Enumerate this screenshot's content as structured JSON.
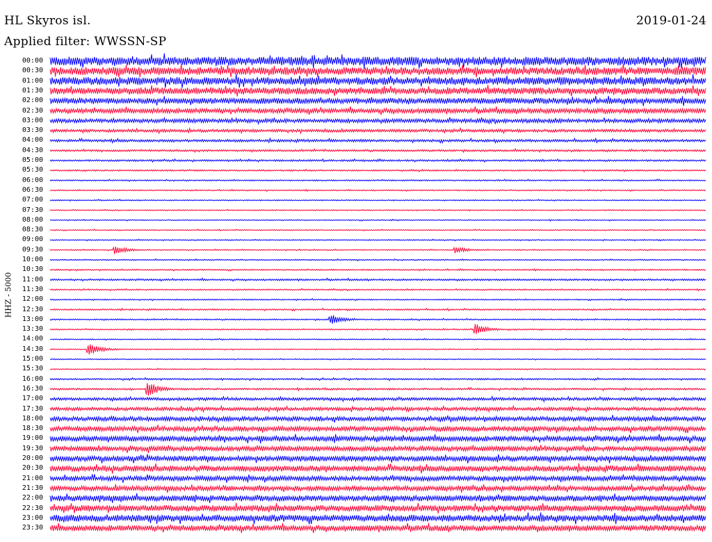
{
  "header": {
    "station": "HL Skyros isl.",
    "date": "2019-01-24",
    "filter": "Applied filter: WWSSN-SP"
  },
  "chart_data": {
    "type": "seismogram",
    "ylabel": "HHZ - 5000",
    "colors": [
      "#0000ff",
      "#ff0033"
    ],
    "row_labels": [
      "00:00",
      "00:30",
      "01:00",
      "01:30",
      "02:00",
      "02:30",
      "03:00",
      "03:30",
      "04:00",
      "04:30",
      "05:00",
      "05:30",
      "06:00",
      "06:30",
      "07:00",
      "07:30",
      "08:00",
      "08:30",
      "09:00",
      "09:30",
      "10:00",
      "10:30",
      "11:00",
      "11:30",
      "12:00",
      "12:30",
      "13:00",
      "13:30",
      "14:00",
      "14:30",
      "15:00",
      "15:30",
      "16:00",
      "16:30",
      "17:00",
      "17:30",
      "18:00",
      "18:30",
      "19:00",
      "19:30",
      "20:00",
      "20:30",
      "21:00",
      "21:30",
      "22:00",
      "22:30",
      "23:00",
      "23:30"
    ],
    "noise_level": [
      9,
      8,
      8,
      7,
      6,
      5,
      4,
      3,
      2.6,
      2,
      1.8,
      1.5,
      1.3,
      1.2,
      1.1,
      1,
      1,
      1,
      1,
      1,
      1.2,
      1.3,
      1.8,
      1.3,
      1.2,
      1.5,
      1.3,
      1.2,
      1.1,
      1,
      1,
      1,
      1.6,
      1.8,
      3,
      3.5,
      4.5,
      5,
      5.5,
      5,
      5.5,
      6,
      5,
      5,
      6,
      6.5,
      7,
      6
    ],
    "events": [
      {
        "row": 19,
        "position": 0.1,
        "amplitude": 12
      },
      {
        "row": 19,
        "position": 0.62,
        "amplitude": 10
      },
      {
        "row": 26,
        "position": 0.43,
        "amplitude": 14
      },
      {
        "row": 27,
        "position": 0.65,
        "amplitude": 16
      },
      {
        "row": 29,
        "position": 0.06,
        "amplitude": 18
      },
      {
        "row": 33,
        "position": 0.15,
        "amplitude": 22
      }
    ]
  }
}
